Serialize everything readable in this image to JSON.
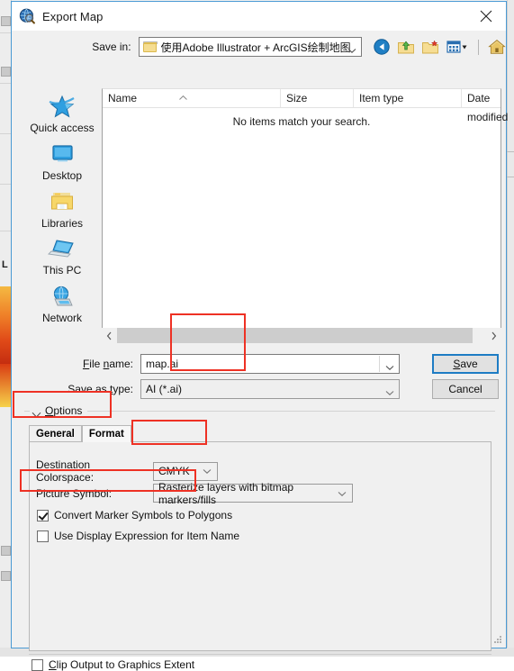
{
  "window": {
    "title": "Export Map",
    "icon": "arcgis-globe-icon",
    "close_label": "✕"
  },
  "navigation": {
    "save_in_label": "Save in:",
    "current_folder": "使用Adobe Illustrator + ArcGIS绘制地图",
    "toolbar": [
      {
        "name": "back-icon",
        "tooltip": "Back"
      },
      {
        "name": "up-one-level-icon",
        "tooltip": "Up One Level"
      },
      {
        "name": "new-folder-icon",
        "tooltip": "Create New Folder"
      },
      {
        "name": "views-icon",
        "tooltip": "Views"
      },
      {
        "name": "home-icon",
        "tooltip": "Home"
      }
    ]
  },
  "places": [
    {
      "label": "Quick access",
      "icon": "star-icon"
    },
    {
      "label": "Desktop",
      "icon": "desktop-icon"
    },
    {
      "label": "Libraries",
      "icon": "libraries-folder-icon"
    },
    {
      "label": "This PC",
      "icon": "laptop-icon"
    },
    {
      "label": "Network",
      "icon": "network-globe-icon"
    }
  ],
  "file_list": {
    "columns": [
      "Name",
      "Size",
      "Item type",
      "Date modified"
    ],
    "empty_message": "No items match your search.",
    "rows": [],
    "sort_indicator": "ascending-caret-icon"
  },
  "file_fields": {
    "file_name_label": "File name:",
    "file_name_value": "map.ai",
    "save_as_type_label": "Save as type:",
    "save_as_type_value": "AI (*.ai)"
  },
  "buttons": {
    "save": "Save",
    "cancel": "Cancel"
  },
  "options": {
    "group_title": "Options",
    "tabs": [
      {
        "label": "General",
        "selected": false
      },
      {
        "label": "Format",
        "selected": true
      }
    ],
    "destination_colorspace": {
      "label": "Destination Colorspace:",
      "value": "CMYK"
    },
    "picture_symbol": {
      "label": "Picture Symbol:",
      "value": "Rasterize layers with bitmap markers/fills"
    },
    "convert_marker_symbols": {
      "label": "Convert Marker Symbols to Polygons",
      "checked": true
    },
    "use_display_expression": {
      "label": "Use Display Expression for Item Name",
      "checked": false
    }
  },
  "footer": {
    "clip_output": {
      "label": "Clip Output to Graphics Extent",
      "checked": false
    }
  },
  "colors": {
    "annotation": "#ee3124",
    "window_border": "#4a9ad4",
    "focus_border": "#1e7cc4",
    "dialog_bg": "#f0f0f0"
  }
}
